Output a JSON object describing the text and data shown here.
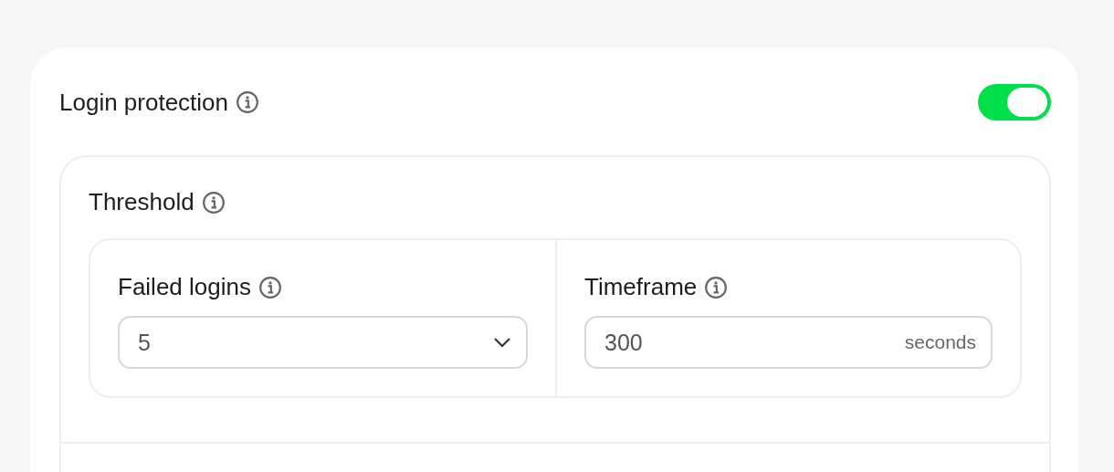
{
  "section": {
    "title": "Login protection",
    "enabled": true
  },
  "threshold": {
    "title": "Threshold",
    "fields": [
      {
        "kind": "select",
        "label": "Failed logins",
        "value": "5"
      },
      {
        "kind": "input",
        "label": "Timeframe",
        "value": "300",
        "unit": "seconds"
      }
    ]
  }
}
